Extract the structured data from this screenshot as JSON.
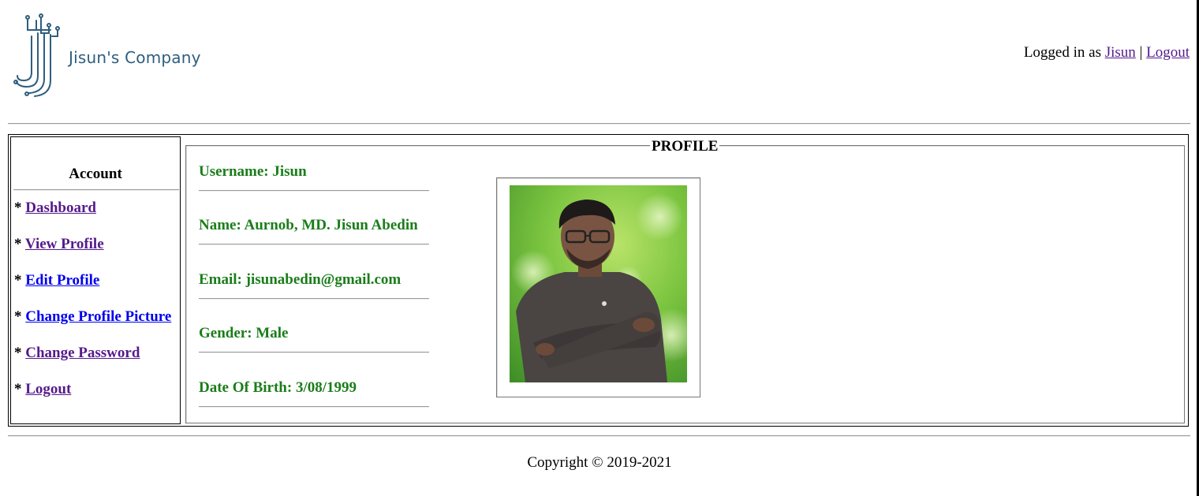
{
  "header": {
    "company_name": "Jisun's Company",
    "logged_in_prefix": "Logged in as ",
    "username_link": "Jisun",
    "separator": " | ",
    "logout_link": "Logout"
  },
  "sidebar": {
    "title": "Account",
    "bullet": "* ",
    "items": [
      {
        "label": "Dashboard"
      },
      {
        "label": "View Profile"
      },
      {
        "label": "Edit Profile"
      },
      {
        "label": "Change Profile Picture"
      },
      {
        "label": "Change Password"
      },
      {
        "label": "Logout"
      }
    ]
  },
  "profile": {
    "legend": "PROFILE",
    "fields": [
      {
        "text": "Username: Jisun"
      },
      {
        "text": "Name: Aurnob, MD. Jisun Abedin"
      },
      {
        "text": "Email: jisunabedin@gmail.com"
      },
      {
        "text": "Gender: Male"
      },
      {
        "text": "Date Of Birth: 3/08/1999"
      }
    ]
  },
  "footer": {
    "copyright": "Copyright © 2019-2021"
  },
  "colors": {
    "field_text": "#1a7d1a",
    "visited_link": "#551a8b",
    "unvisited_link": "#0000ee",
    "logo_blue": "#2e5e7e"
  }
}
